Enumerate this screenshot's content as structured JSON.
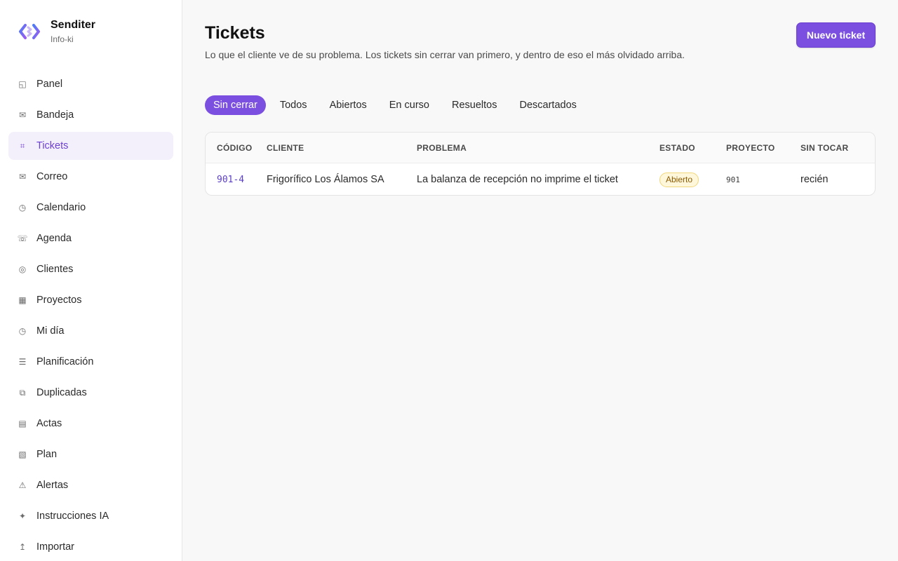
{
  "brand": {
    "name": "Senditer",
    "subtitle": "Info-ki"
  },
  "colors": {
    "accent": "#7b4fe0",
    "active_bg": "#f3f0fc",
    "badge_bg": "#fef7db",
    "badge_text": "#8a5a00"
  },
  "sidebar": {
    "items": [
      {
        "label": "Panel",
        "icon": "panel-icon",
        "glyph": "◱",
        "active": false
      },
      {
        "label": "Bandeja",
        "icon": "inbox-icon",
        "glyph": "✉",
        "active": false
      },
      {
        "label": "Tickets",
        "icon": "ticket-icon",
        "glyph": "⌗",
        "active": true
      },
      {
        "label": "Correo",
        "icon": "mail-icon",
        "glyph": "✉",
        "active": false
      },
      {
        "label": "Calendario",
        "icon": "clock-icon",
        "glyph": "◷",
        "active": false
      },
      {
        "label": "Agenda",
        "icon": "phone-icon",
        "glyph": "☏",
        "active": false
      },
      {
        "label": "Clientes",
        "icon": "target-icon",
        "glyph": "◎",
        "active": false
      },
      {
        "label": "Proyectos",
        "icon": "grid-icon",
        "glyph": "▦",
        "active": false
      },
      {
        "label": "Mi día",
        "icon": "clock-icon",
        "glyph": "◷",
        "active": false
      },
      {
        "label": "Planificación",
        "icon": "list-icon",
        "glyph": "☰",
        "active": false
      },
      {
        "label": "Duplicadas",
        "icon": "duplicate-icon",
        "glyph": "⧉",
        "active": false
      },
      {
        "label": "Actas",
        "icon": "document-icon",
        "glyph": "▤",
        "active": false
      },
      {
        "label": "Plan",
        "icon": "plan-icon",
        "glyph": "▧",
        "active": false
      },
      {
        "label": "Alertas",
        "icon": "alert-icon",
        "glyph": "⚠",
        "active": false
      },
      {
        "label": "Instrucciones IA",
        "icon": "sparkle-icon",
        "glyph": "✦",
        "active": false
      },
      {
        "label": "Importar",
        "icon": "import-icon",
        "glyph": "↥",
        "active": false
      }
    ]
  },
  "header": {
    "title": "Tickets",
    "description": "Lo que el cliente ve de su problema. Los tickets sin cerrar van primero, y dentro de eso el más olvidado arriba.",
    "new_button": "Nuevo ticket"
  },
  "tabs": [
    {
      "label": "Sin cerrar",
      "active": true
    },
    {
      "label": "Todos",
      "active": false
    },
    {
      "label": "Abiertos",
      "active": false
    },
    {
      "label": "En curso",
      "active": false
    },
    {
      "label": "Resueltos",
      "active": false
    },
    {
      "label": "Descartados",
      "active": false
    }
  ],
  "table": {
    "columns": [
      "CÓDIGO",
      "CLIENTE",
      "PROBLEMA",
      "ESTADO",
      "PROYECTO",
      "SIN TOCAR"
    ],
    "rows": [
      {
        "code": "901-4",
        "client": "Frigorífico Los Álamos SA",
        "problem": "La balanza de recepción no imprime el ticket",
        "status": "Abierto",
        "project": "901",
        "untouched": "recién"
      }
    ]
  }
}
